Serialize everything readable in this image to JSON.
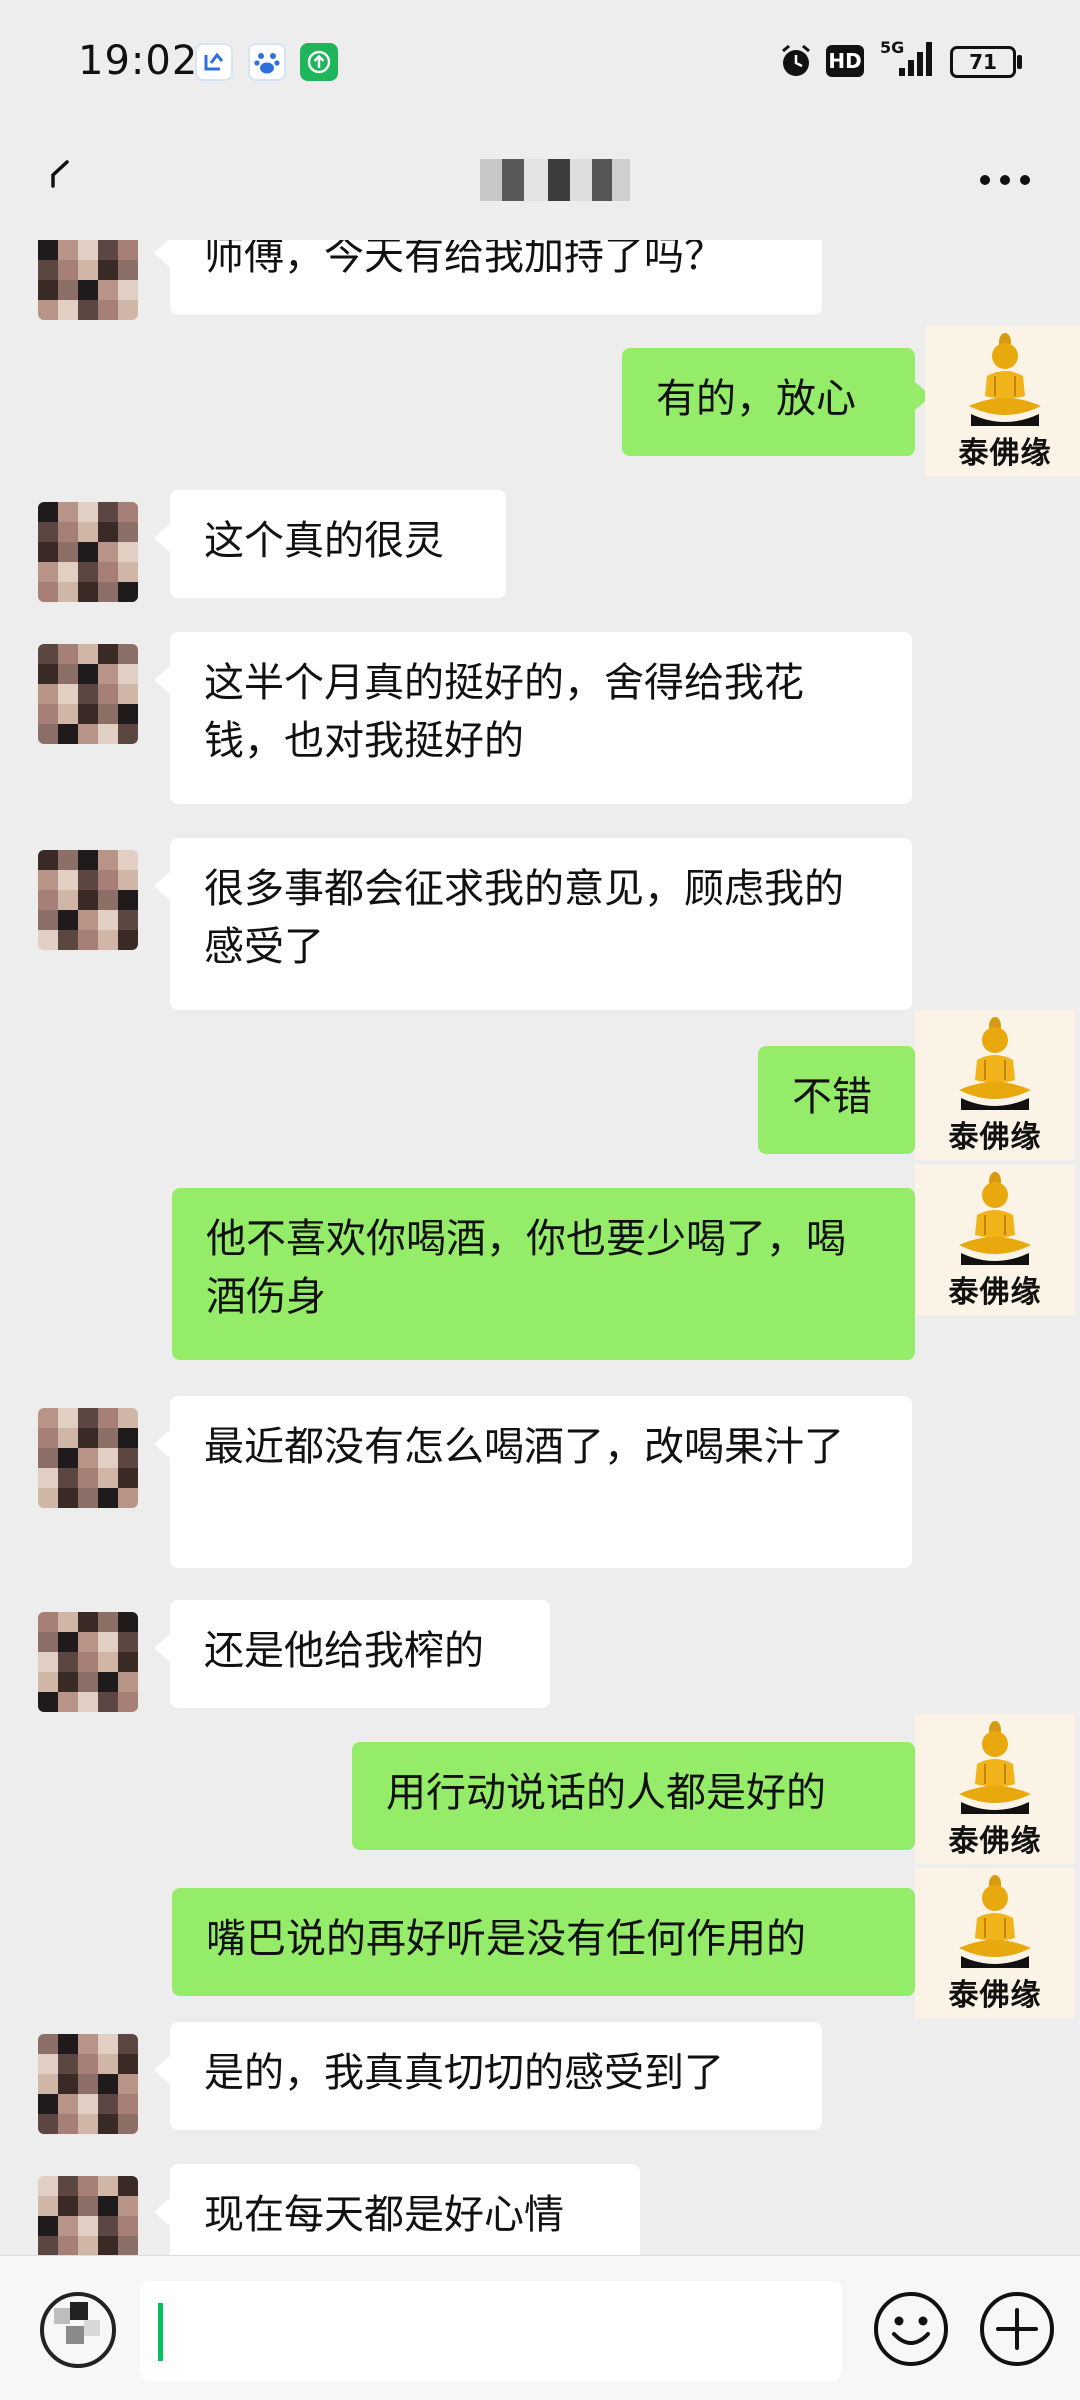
{
  "status_bar": {
    "time": "19:02",
    "battery_level": "71",
    "network": "5G",
    "hd_label": "HD"
  },
  "header": {
    "more_label": "···"
  },
  "buddha_label": "泰佛缘",
  "messages": [
    {
      "side": "in",
      "text": "师傅，今天有给我加持了吗？"
    },
    {
      "side": "out",
      "text": "有的，放心"
    },
    {
      "side": "in",
      "text": "这个真的很灵"
    },
    {
      "side": "in",
      "text": "这半个月真的挺好的，舍得给我花钱，也对我挺好的"
    },
    {
      "side": "in",
      "text": "很多事都会征求我的意见，顾虑我的感受了"
    },
    {
      "side": "out",
      "text": "不错"
    },
    {
      "side": "out",
      "text": "他不喜欢你喝酒，你也要少喝了，喝酒伤身"
    },
    {
      "side": "in",
      "text": "最近都没有怎么喝酒了，改喝果汁了"
    },
    {
      "side": "in",
      "text": "还是他给我榨的"
    },
    {
      "side": "out",
      "text": "用行动说话的人都是好的"
    },
    {
      "side": "out",
      "text": "嘴巴说的再好听是没有任何作用的"
    },
    {
      "side": "in",
      "text": "是的，我真真切切的感受到了"
    },
    {
      "side": "in",
      "text": "现在每天都是好心情"
    }
  ],
  "colors": {
    "background": "#ededed",
    "incoming_bubble": "#ffffff",
    "outgoing_bubble": "#95ec69",
    "cursor": "#07c160"
  },
  "input_bar": {
    "voice_icon": "voice-icon",
    "emoji_icon": "emoji-icon",
    "plus_icon": "plus-icon"
  }
}
